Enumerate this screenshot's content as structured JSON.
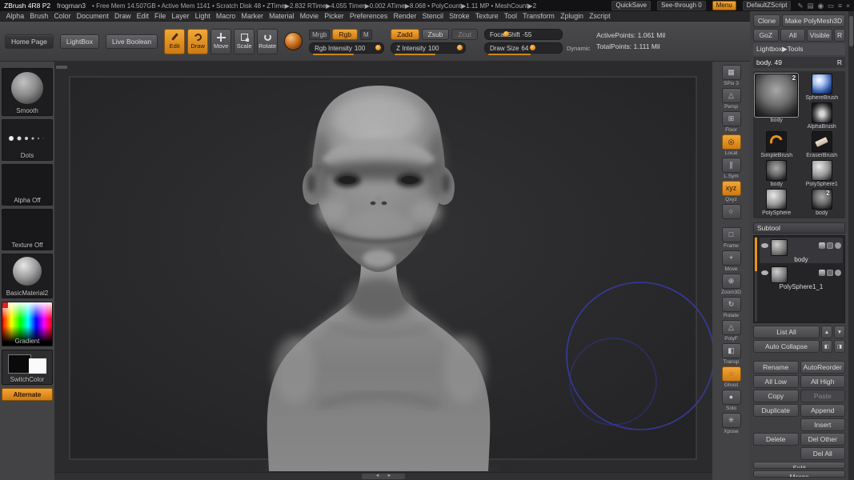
{
  "titlebar": {
    "app_title": "ZBrush 4R8 P2",
    "document_name": "frogman3",
    "stats": "• Free Mem 14.507GB  • Active Mem 1141  • Scratch Disk 48  • ZTime▶2.832  RTime▶4.055  Timer▶0.002  ATime▶8.068  • PolyCount▶1.11 MP  • MeshCount▶2",
    "quicksave": "QuickSave",
    "see_through": "See-through 0",
    "menu": "Menu",
    "zscript": "DefaultZScript",
    "icons": [
      "✎",
      "▤",
      "◉",
      "▭",
      "≡",
      "×"
    ]
  },
  "menubar": {
    "items": [
      "Alpha",
      "Brush",
      "Color",
      "Document",
      "Draw",
      "Edit",
      "File",
      "Layer",
      "Light",
      "Macro",
      "Marker",
      "Material",
      "Movie",
      "Picker",
      "Preferences",
      "Render",
      "Stencil",
      "Stroke",
      "Texture",
      "Tool",
      "Transform",
      "Zplugin",
      "Zscript"
    ]
  },
  "shelf": {
    "home_page": "Home Page",
    "lightbox": "LightBox",
    "live_boolean": "Live Boolean",
    "edit": "Edit",
    "draw": "Draw",
    "move": "Move",
    "scale": "Scale",
    "rotate": "Rotate",
    "mrgb": "Mrgb",
    "rgb": "Rgb",
    "m": "M",
    "rgb_intensity": {
      "label": "Rgb Intensity",
      "value": "100"
    },
    "zadd": "Zadd",
    "zsub": "Zsub",
    "zcut": "Zcut",
    "z_intensity": {
      "label": "Z Intensity",
      "value": "100"
    },
    "focal_shift": {
      "label": "Focal Shift",
      "value": "-55"
    },
    "draw_size": {
      "label": "Draw Size",
      "value": "64"
    },
    "dynamic": "Dynamic",
    "active_points": "ActivePoints: 1.061 Mil",
    "total_points": "TotalPoints: 1.111 Mil"
  },
  "left_tray": {
    "items": [
      {
        "label": "Smooth",
        "type": "brush"
      },
      {
        "label": "Dots",
        "type": "stroke"
      },
      {
        "label": "Alpha Off",
        "type": "alpha"
      },
      {
        "label": "Texture Off",
        "type": "texture"
      },
      {
        "label": "BasicMaterial2",
        "type": "material"
      },
      {
        "label": "Gradient",
        "type": "gradient"
      },
      {
        "label": "SwitchColor",
        "type": "switch"
      },
      {
        "label": "Alternate",
        "type": "alternate"
      }
    ]
  },
  "right_shelf": {
    "items": [
      {
        "label": "SPix 3",
        "icon": "▦",
        "type": "spix"
      },
      {
        "label": "Persp",
        "icon": "△",
        "type": "persp"
      },
      {
        "label": "Floor",
        "icon": "⊞",
        "type": "floor"
      },
      {
        "label": "Local",
        "icon": "◎",
        "type": "local",
        "active": true
      },
      {
        "label": "L.Sym",
        "icon": "∥",
        "type": "lsym"
      },
      {
        "label": "Qxyz",
        "icon": "xyz",
        "type": "qxyz",
        "active": true
      },
      {
        "label": "",
        "icon": "○",
        "type": "radial"
      },
      {
        "label": "Frame",
        "icon": "□",
        "type": "frame"
      },
      {
        "label": "Move",
        "icon": "+",
        "type": "move"
      },
      {
        "label": "Zoom3D",
        "icon": "⊕",
        "type": "zoom"
      },
      {
        "label": "Rotate",
        "icon": "↻",
        "type": "rotate"
      },
      {
        "label": "PolyF",
        "icon": "△",
        "type": "polyf"
      },
      {
        "label": "Transp",
        "icon": "◧",
        "type": "transp"
      },
      {
        "label": "Ghost",
        "icon": "◌",
        "type": "ghost",
        "active": true
      },
      {
        "label": "Solo",
        "icon": "●",
        "type": "solo"
      },
      {
        "label": "Xpose",
        "icon": "✳",
        "type": "xpose"
      }
    ]
  },
  "tool_panel": {
    "clone": "Clone",
    "make_polymesh": "Make PolyMesh3D",
    "goz": "GoZ",
    "all": "All",
    "visible": "Visible",
    "restore": "R",
    "lightbox_tools": "Lightbox▶Tools",
    "current_tool": "body. 49",
    "thumbnails": [
      {
        "label": "body",
        "type": "creature",
        "badge": "2",
        "selected": true
      },
      {
        "label": "SphereBrush",
        "type": "sphere-blue"
      },
      {
        "label": "AlphaBrush",
        "type": "alphabrush"
      },
      {
        "label": "SimpleBrush",
        "type": "simplebrush"
      },
      {
        "label": "EraserBrush",
        "type": "eraserbrush"
      },
      {
        "label": "body",
        "type": "creature-small"
      },
      {
        "label": "PolySphere1",
        "type": "polysphere"
      },
      {
        "label": "PolySphere",
        "type": "polysphere"
      },
      {
        "label": "body",
        "type": "creature-small",
        "badge": "2"
      }
    ]
  },
  "subtool": {
    "header": "Subtool",
    "items": [
      {
        "name": "body",
        "selected": true
      },
      {
        "name": "PolySphere1_1"
      }
    ],
    "list_all": "List All",
    "up_icon": "▲",
    "down_icon": "▼",
    "auto_collapse": "Auto Collapse",
    "collapse_left_icon": "◧",
    "collapse_right_icon": "◨",
    "rename": "Rename",
    "autoreorder": "AutoReorder",
    "all_low": "All Low",
    "all_high": "All High",
    "copy": "Copy",
    "paste": "Paste",
    "duplicate": "Duplicate",
    "append": "Append",
    "insert": "Insert",
    "delete": "Delete",
    "del_other": "Del Other",
    "del_all": "Del All",
    "split": "Split",
    "merge": "Merge"
  },
  "canvas": {
    "scrub_left": "◄",
    "scrub_right": "►"
  },
  "colors": {
    "accent_orange": "#e8941a",
    "ring_blue": "#3c3cb4",
    "canvas_bg": "#2a2a2c"
  }
}
